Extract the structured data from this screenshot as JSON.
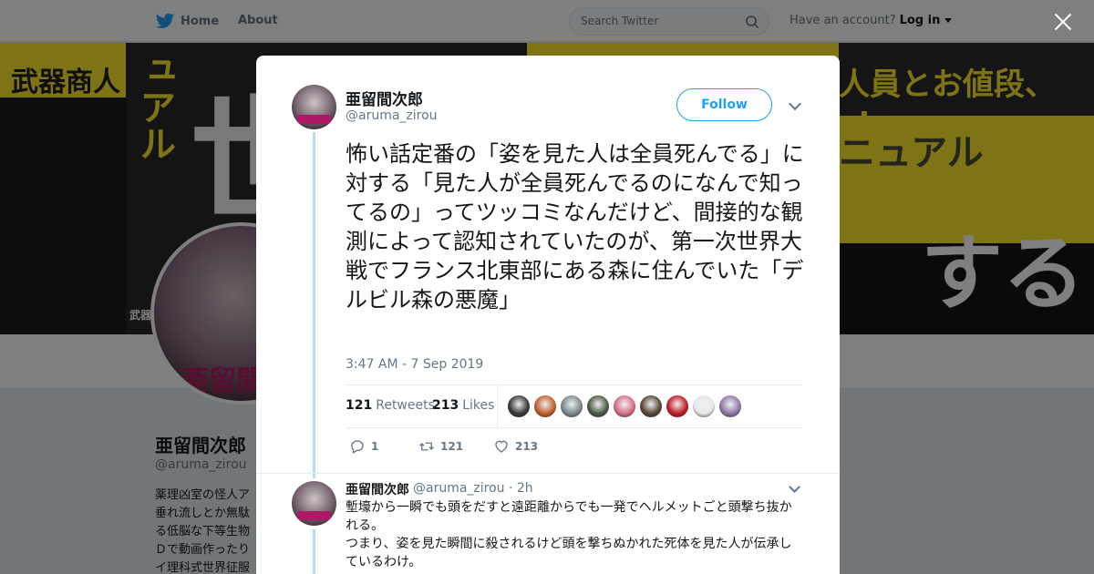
{
  "nav": {
    "home_label": "Home",
    "about_label": "About",
    "search_placeholder": "Search Twitter",
    "account_prompt": "Have an account?",
    "login_label": "Log in"
  },
  "banner": {
    "text_1": "武器商人",
    "text_2": "ュアル",
    "text_3": "人員とお値段、etc.",
    "text_4": "ニュアル",
    "text_5": "世",
    "text_6": "する",
    "text_7": "武器"
  },
  "profile": {
    "name": "亜留間次郎",
    "handle": "@aruma_zirou",
    "avatar_stamp": "亜留間",
    "bio": "薬理凶室の怪人ア垂れ流しとか無駄る低脳な下等生物Ｄで動画作ったりイ理科式世界征服"
  },
  "tweet": {
    "author_name": "亜留間次郎",
    "author_handle": "@aruma_zirou",
    "follow_label": "Follow",
    "text": "怖い話定番の「姿を見た人は全員死んでる」に対する「見た人が全員死んでるのになんで知ってるの」ってツッコミなんだけど、間接的な観測によって認知されていたのが、第一次世界大戦でフランス北東部にある森に住んでいた「デルビル森の悪魔」",
    "timestamp": "3:47 AM - 7 Sep 2019",
    "retweets_count": "121",
    "retweets_label": "Retweets",
    "likes_count": "213",
    "likes_label": "Likes",
    "reply_action_count": "1",
    "retweet_action_count": "121",
    "like_action_count": "213"
  },
  "likers": [
    "#3a3a3a",
    "#c06030",
    "#7b8a8f",
    "#4c5a48",
    "#d77088",
    "#5a4638",
    "#c01c28",
    "#e8e8e8",
    "#8e7aa8"
  ],
  "reply": {
    "author_name": "亜留間次郎",
    "author_handle": "@aruma_zirou · 2h",
    "line_1": "塹壕から一瞬でも頭をだすと遠距離からでも一発でヘルメットごと頭撃ち抜かれる。",
    "line_2": "つまり、姿を見た瞬間に殺されるけど頭を撃ちぬかれた死体を見た人が伝承しているわけ。"
  },
  "colors": {
    "accent": "#1da1f2",
    "banner_yellow": "#ffe82a",
    "thread_line": "#b7dbf4"
  }
}
